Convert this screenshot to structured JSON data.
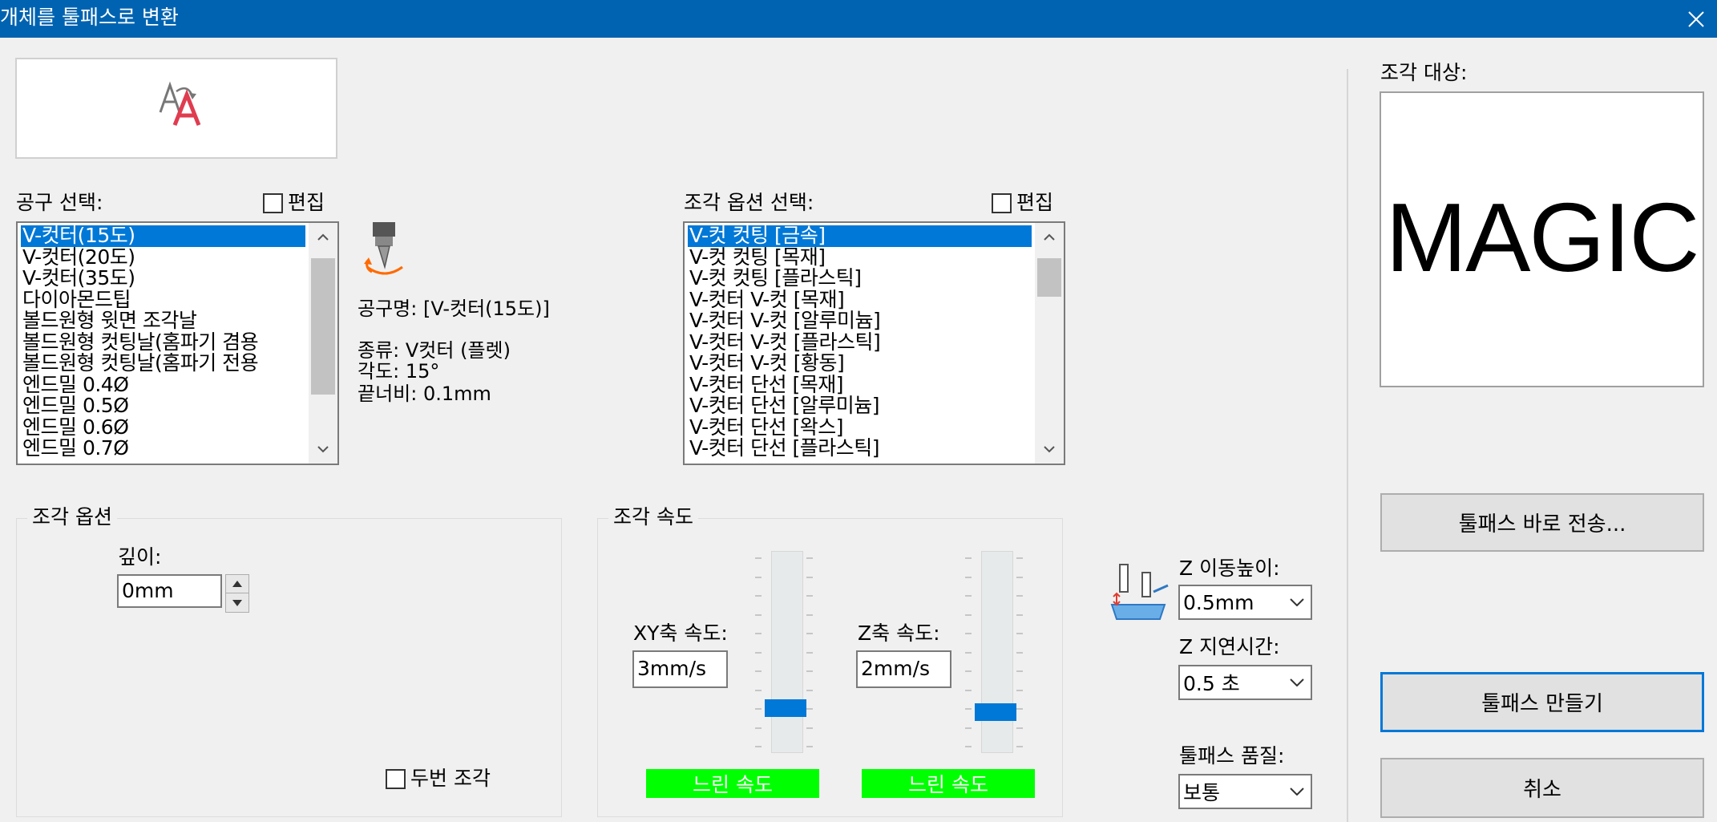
{
  "window": {
    "title": "개체를 툴패스로 변환"
  },
  "tool_select": {
    "label": "공구 선택:",
    "edit_label": "편집",
    "items": [
      "V-컷터(15도)",
      "V-컷터(20도)",
      "V-컷터(35도)",
      "다이아몬드팁",
      "볼드원형 윗면 조각날",
      "볼드원형 컷팅날(홈파기 겸용",
      "볼드원형 컷팅날(홈파기 전용",
      "엔드밀 0.4Ø",
      "엔드밀 0.5Ø",
      "엔드밀 0.6Ø",
      "엔드밀 0.7Ø"
    ],
    "selected_index": 0
  },
  "tool_info": {
    "name": "공구명: [V-컷터(15도)]",
    "type": "종류: V컷터 (플렛)",
    "angle": "각도: 15°",
    "tip_width": "끝너비: 0.1mm"
  },
  "engrave_option_select": {
    "label": "조각 옵션 선택:",
    "edit_label": "편집",
    "items": [
      "V-컷 컷팅 [금속]",
      "V-컷 컷팅 [목재]",
      "V-컷 컷팅 [플라스틱]",
      "V-컷터 V-컷 [목재]",
      "V-컷터 V-컷 [알루미늄]",
      "V-컷터 V-컷 [플라스틱]",
      "V-컷터 V-컷 [황동]",
      "V-컷터 단선 [목재]",
      "V-컷터 단선 [알루미늄]",
      "V-컷터 단선 [왁스]",
      "V-컷터 단선 [플라스틱]"
    ],
    "selected_index": 0
  },
  "engrave_options": {
    "title": "조각 옵션",
    "depth_label": "깊이:",
    "depth_value": "0mm",
    "double_engrave_label": "두번 조각"
  },
  "engrave_speed": {
    "title": "조각 속도",
    "xy_label": "XY축 속도:",
    "xy_value": "3mm/s",
    "xy_status": "느린 속도",
    "xy_level": 0.1,
    "z_label": "Z축 속도:",
    "z_value": "2mm/s",
    "z_status": "느린 속도",
    "z_level": 0.08
  },
  "z_settings": {
    "move_height_label": "Z 이동높이:",
    "move_height_value": "0.5mm",
    "delay_label": "Z 지연시간:",
    "delay_value": "0.5 초",
    "quality_label": "툴패스 품질:",
    "quality_value": "보통"
  },
  "target": {
    "label": "조각 대상:",
    "preview_text": "MAGIC"
  },
  "buttons": {
    "send": "툴패스 바로 전송...",
    "create": "툴패스 만들기",
    "cancel": "취소"
  },
  "colors": {
    "accent": "#0078d7",
    "titlebar": "#0063b1",
    "speed_status": "#00ff00"
  }
}
